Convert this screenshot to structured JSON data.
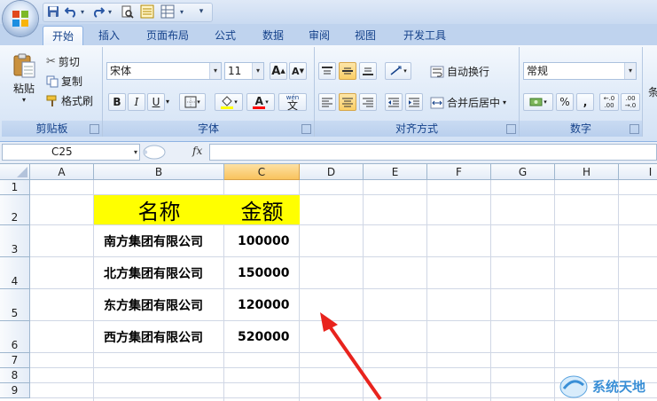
{
  "quick_access": {
    "menu_arrow": "▾"
  },
  "tabs": [
    "开始",
    "插入",
    "页面布局",
    "公式",
    "数据",
    "审阅",
    "视图",
    "开发工具"
  ],
  "active_tab": "开始",
  "clipboard": {
    "paste_label": "粘贴",
    "cut_label": "剪切",
    "copy_label": "复制",
    "format_painter_label": "格式刷",
    "group_label": "剪贴板"
  },
  "font": {
    "name": "宋体",
    "size": "11",
    "grow_label": "A",
    "shrink_label": "A",
    "bold": "B",
    "italic": "I",
    "underline": "U",
    "font_color_letter": "A",
    "phonetic_label": "wén",
    "phonetic_char": "文",
    "group_label": "字体"
  },
  "alignment": {
    "wrap_label": "自动换行",
    "merge_label": "合并后居中",
    "group_label": "对齐方式"
  },
  "number": {
    "format": "常规",
    "percent": "%",
    "comma": ",",
    "inc_decimal": "←.0 .00",
    "dec_decimal": ".00 →.0",
    "group_label": "数字"
  },
  "styles": {
    "cut_label": "条"
  },
  "formula_bar": {
    "name_box": "C25",
    "fx": "fx",
    "formula": ""
  },
  "columns": [
    "A",
    "B",
    "C",
    "D",
    "E",
    "F",
    "G",
    "H",
    "I"
  ],
  "selected_column": "C",
  "rows": [
    "1",
    "2",
    "3",
    "4",
    "5",
    "6",
    "7",
    "8",
    "9"
  ],
  "sheet": {
    "header_name": "名称",
    "header_amount": "金额",
    "data": [
      {
        "name": "南方集团有限公司",
        "amount": "100000"
      },
      {
        "name": "北方集团有限公司",
        "amount": "150000"
      },
      {
        "name": "东方集团有限公司",
        "amount": "120000"
      },
      {
        "name": "西方集团有限公司",
        "amount": "520000"
      }
    ]
  },
  "colors": {
    "header_fill": "#ffff00",
    "arrow": "#e8231d",
    "ribbon_text": "#15428b",
    "selected_header": "#f9c35d"
  },
  "watermark": {
    "text": "系统天地"
  }
}
